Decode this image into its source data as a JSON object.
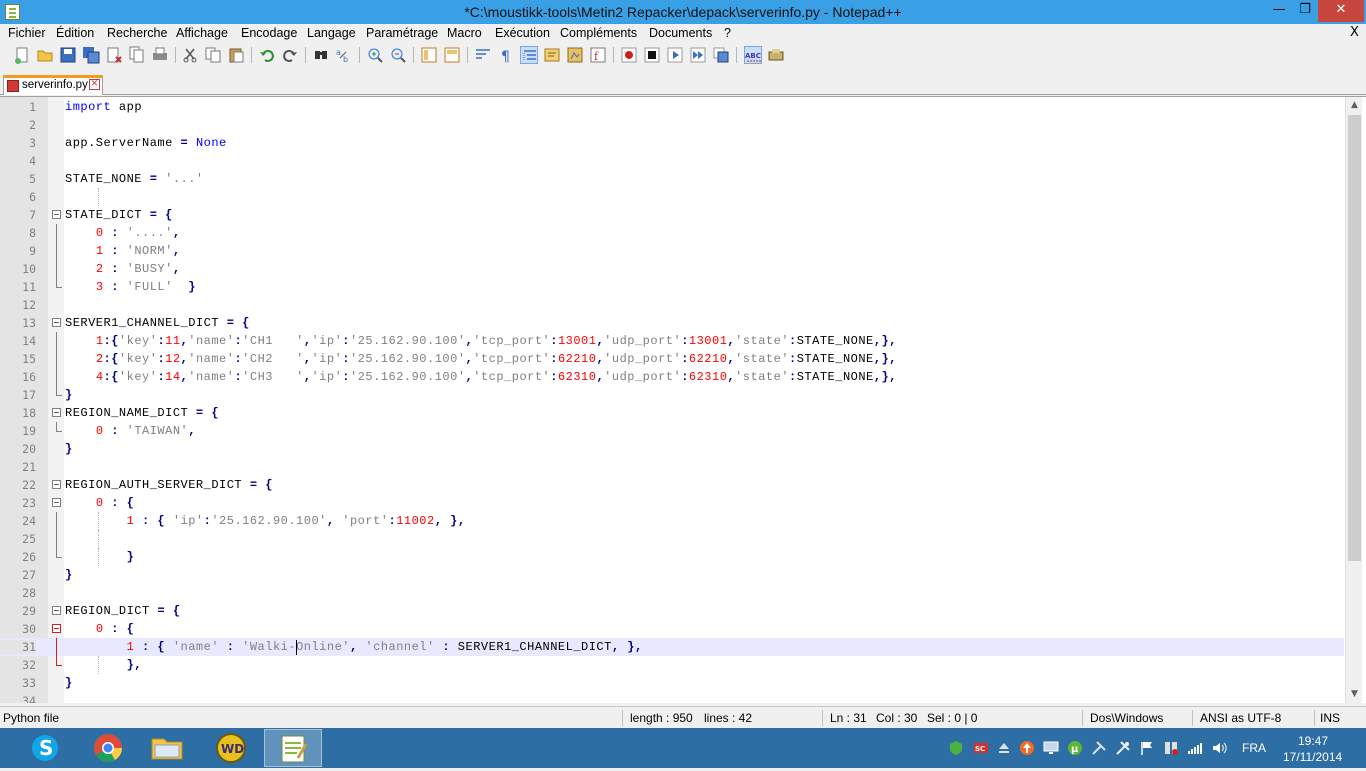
{
  "window": {
    "title": "*C:\\moustikk-tools\\Metin2 Repacker\\depack\\serverinfo.py - Notepad++",
    "minimize": "—",
    "maximize": "❐",
    "close": "✕"
  },
  "menu": [
    "Fichier",
    "Édition",
    "Recherche",
    "Affichage",
    "Encodage",
    "Langage",
    "Paramétrage",
    "Macro",
    "Exécution",
    "Compléments",
    "Documents",
    "?"
  ],
  "menu_close": "X",
  "tab": {
    "label": "serverinfo.py",
    "close": "✕"
  },
  "editor": {
    "lines": [
      "1",
      "2",
      "3",
      "4",
      "5",
      "6",
      "7",
      "8",
      "9",
      "10",
      "11",
      "12",
      "13",
      "14",
      "15",
      "16",
      "17",
      "18",
      "19",
      "20",
      "21",
      "22",
      "23",
      "24",
      "25",
      "26",
      "27",
      "28",
      "29",
      "30",
      "31",
      "32",
      "33",
      "34"
    ],
    "current_line": "31"
  },
  "status": {
    "filetype": "Python file",
    "length": "length : 950",
    "lines": "lines : 42",
    "ln": "Ln : 31",
    "col": "Col : 30",
    "sel": "Sel : 0 | 0",
    "eol": "Dos\\Windows",
    "encoding": "ANSI as UTF-8",
    "mode": "INS"
  },
  "taskbar": {
    "language": "FRA",
    "time": "19:47",
    "date": "17/11/2014",
    "apps": [
      "skype-icon",
      "chrome-icon",
      "file-explorer-icon",
      "wd-icon",
      "notepad-plus-plus-icon"
    ]
  },
  "colors": {
    "keyword": "#0000ff",
    "number": "#ff0000",
    "string": "#808080",
    "operator": "#000080",
    "current_line": "#e8e8ff",
    "titlebar": "#3aa0e6",
    "taskbar": "#2d6ea4"
  }
}
